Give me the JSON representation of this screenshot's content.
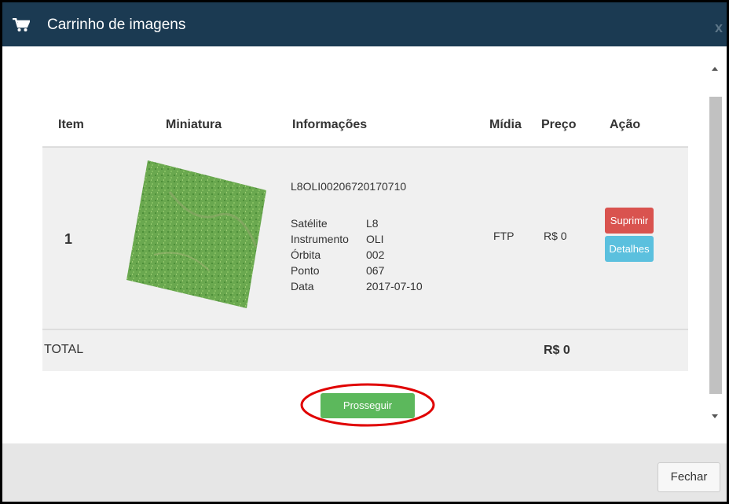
{
  "header": {
    "title": "Carrinho de imagens",
    "close_label": "x",
    "cart_icon": "cart-icon"
  },
  "table": {
    "columns": [
      "Item",
      "Miniatura",
      "Informações",
      "Mídia",
      "Preço",
      "Ação"
    ],
    "rows": [
      {
        "item": "1",
        "thumbnail_icon": "satellite-image-thumbnail",
        "id": "L8OLI00206720170710",
        "info": [
          {
            "label": "Satélite",
            "value": "L8"
          },
          {
            "label": "Instrumento",
            "value": "OLI"
          },
          {
            "label": "Órbita",
            "value": "002"
          },
          {
            "label": "Ponto",
            "value": "067"
          },
          {
            "label": "Data",
            "value": "2017-07-10"
          }
        ],
        "midia": "FTP",
        "preco": "R$ 0",
        "actions": {
          "remove": "Suprimir",
          "details": "Detalhes"
        }
      }
    ],
    "total_label": "TOTAL",
    "total_value": "R$  0"
  },
  "proceed_label": "Prosseguir",
  "footer": {
    "close_label": "Fechar"
  },
  "colors": {
    "header_bg": "#1b3a52",
    "danger": "#d9534f",
    "info": "#5bc0de",
    "success": "#5cb85c",
    "highlight": "#e00000"
  }
}
